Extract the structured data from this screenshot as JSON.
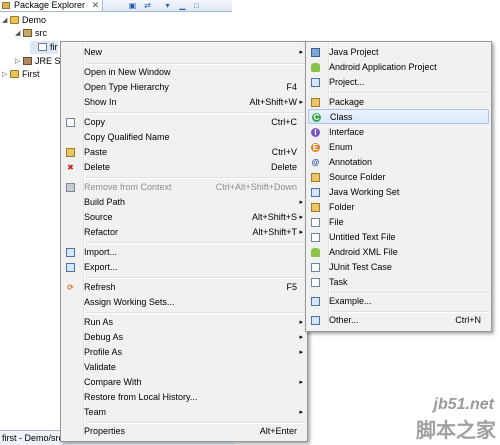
{
  "explorer": {
    "tab_title": "Package Explorer",
    "close_glyph": "✕",
    "tree": [
      {
        "label": "Demo",
        "twisty": "◢",
        "icon": "project"
      },
      {
        "label": "src",
        "twisty": "◢",
        "icon": "package"
      },
      {
        "label": "fir",
        "twisty": "",
        "icon": "file"
      },
      {
        "label": "JRE S",
        "twisty": "▷",
        "icon": "library"
      },
      {
        "label": "First",
        "twisty": "▷",
        "icon": "project"
      }
    ],
    "status_text": "first - Demo/src"
  },
  "main_menu": {
    "items": [
      {
        "label": "New",
        "shortcut": "",
        "arrow": "▸",
        "icon": ""
      },
      {
        "label": "Open in New Window",
        "shortcut": "",
        "arrow": "",
        "icon": ""
      },
      {
        "label": "Open Type Hierarchy",
        "shortcut": "F4",
        "arrow": "",
        "icon": ""
      },
      {
        "label": "Show In",
        "shortcut": "Alt+Shift+W",
        "arrow": "▸",
        "icon": ""
      },
      {
        "label": "Copy",
        "shortcut": "Ctrl+C",
        "arrow": "",
        "icon": "copy-icon"
      },
      {
        "label": "Copy Qualified Name",
        "shortcut": "",
        "arrow": "",
        "icon": "copy-qualified-icon"
      },
      {
        "label": "Paste",
        "shortcut": "Ctrl+V",
        "arrow": "",
        "icon": "paste-icon"
      },
      {
        "label": "Delete",
        "shortcut": "Delete",
        "arrow": "",
        "icon": "delete-icon"
      },
      {
        "label": "Remove from Context",
        "shortcut": "Ctrl+Alt+Shift+Down",
        "arrow": "",
        "icon": "remove-context-icon",
        "disabled": true
      },
      {
        "label": "Build Path",
        "shortcut": "",
        "arrow": "▸",
        "icon": ""
      },
      {
        "label": "Source",
        "shortcut": "Alt+Shift+S",
        "arrow": "▸",
        "icon": ""
      },
      {
        "label": "Refactor",
        "shortcut": "Alt+Shift+T",
        "arrow": "▸",
        "icon": ""
      },
      {
        "label": "Import...",
        "shortcut": "",
        "arrow": "",
        "icon": "import-icon"
      },
      {
        "label": "Export...",
        "shortcut": "",
        "arrow": "",
        "icon": "export-icon"
      },
      {
        "label": "Refresh",
        "shortcut": "F5",
        "arrow": "",
        "icon": "refresh-icon"
      },
      {
        "label": "Assign Working Sets...",
        "shortcut": "",
        "arrow": "",
        "icon": ""
      },
      {
        "label": "Run As",
        "shortcut": "",
        "arrow": "▸",
        "icon": ""
      },
      {
        "label": "Debug As",
        "shortcut": "",
        "arrow": "▸",
        "icon": ""
      },
      {
        "label": "Profile As",
        "shortcut": "",
        "arrow": "▸",
        "icon": ""
      },
      {
        "label": "Validate",
        "shortcut": "",
        "arrow": "",
        "icon": ""
      },
      {
        "label": "Compare With",
        "shortcut": "",
        "arrow": "▸",
        "icon": ""
      },
      {
        "label": "Restore from Local History...",
        "shortcut": "",
        "arrow": "",
        "icon": ""
      },
      {
        "label": "Team",
        "shortcut": "",
        "arrow": "▸",
        "icon": ""
      },
      {
        "label": "Properties",
        "shortcut": "Alt+Enter",
        "arrow": "",
        "icon": ""
      }
    ]
  },
  "sub_menu": {
    "items": [
      {
        "label": "Java Project",
        "shortcut": "",
        "icon": "java-project-icon"
      },
      {
        "label": "Android Application Project",
        "shortcut": "",
        "icon": "android-project-icon"
      },
      {
        "label": "Project...",
        "shortcut": "",
        "icon": "project-icon"
      },
      {
        "label": "Package",
        "shortcut": "",
        "icon": "package-icon"
      },
      {
        "label": "Class",
        "shortcut": "",
        "icon": "class-icon",
        "highlighted": true
      },
      {
        "label": "Interface",
        "shortcut": "",
        "icon": "interface-icon"
      },
      {
        "label": "Enum",
        "shortcut": "",
        "icon": "enum-icon"
      },
      {
        "label": "Annotation",
        "shortcut": "",
        "icon": "annotation-icon"
      },
      {
        "label": "Source Folder",
        "shortcut": "",
        "icon": "source-folder-icon"
      },
      {
        "label": "Java Working Set",
        "shortcut": "",
        "icon": "working-set-icon"
      },
      {
        "label": "Folder",
        "shortcut": "",
        "icon": "folder-icon"
      },
      {
        "label": "File",
        "shortcut": "",
        "icon": "file-icon"
      },
      {
        "label": "Untitled Text File",
        "shortcut": "",
        "icon": "text-file-icon"
      },
      {
        "label": "Android XML File",
        "shortcut": "",
        "icon": "android-xml-icon"
      },
      {
        "label": "JUnit Test Case",
        "shortcut": "",
        "icon": "junit-icon"
      },
      {
        "label": "Task",
        "shortcut": "",
        "icon": "task-icon"
      },
      {
        "label": "Example...",
        "shortcut": "",
        "icon": "example-icon"
      },
      {
        "label": "Other...",
        "shortcut": "Ctrl+N",
        "icon": "other-icon"
      }
    ]
  },
  "watermark": {
    "line1": "jb51.net",
    "line2": "脚本之家"
  }
}
